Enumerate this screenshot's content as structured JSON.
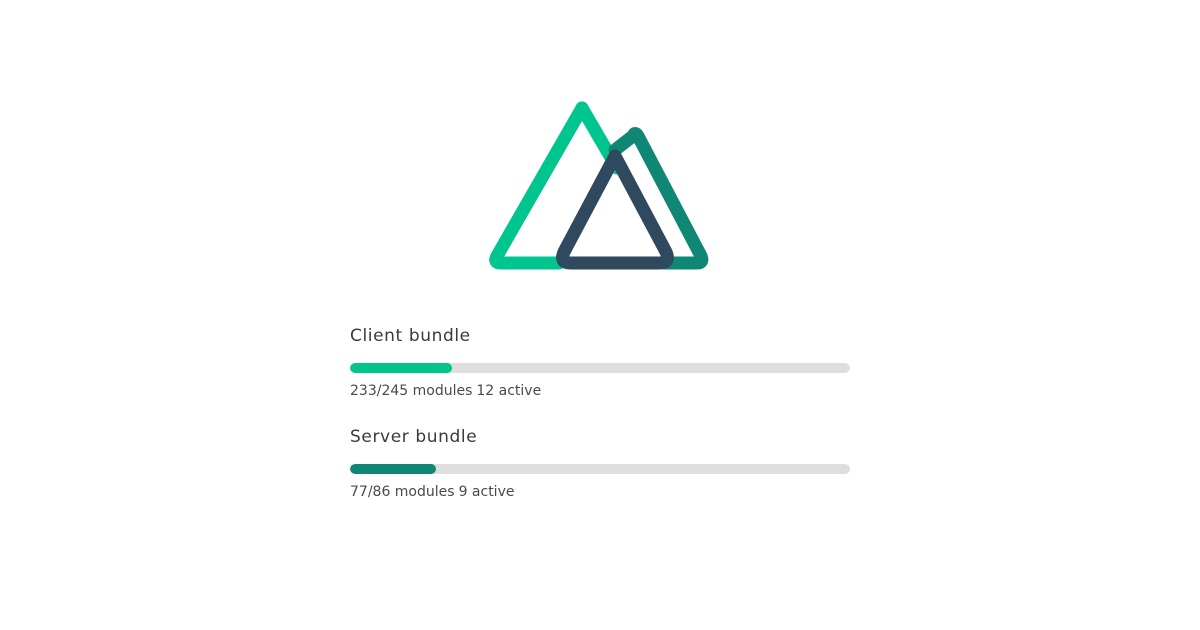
{
  "colors": {
    "background": "#ffffff",
    "logo_left": "#00c58e",
    "logo_right": "#108775",
    "logo_front": "#2f495e",
    "track": "#dedede"
  },
  "bundles": [
    {
      "name": "Client bundle",
      "progress_fraction": 0.204,
      "color": "#00c58e",
      "modules": "233/245 modules",
      "active": "12 active"
    },
    {
      "name": "Server bundle",
      "progress_fraction": 0.172,
      "color": "#108775",
      "modules": "77/86 modules",
      "active": "9 active"
    }
  ]
}
